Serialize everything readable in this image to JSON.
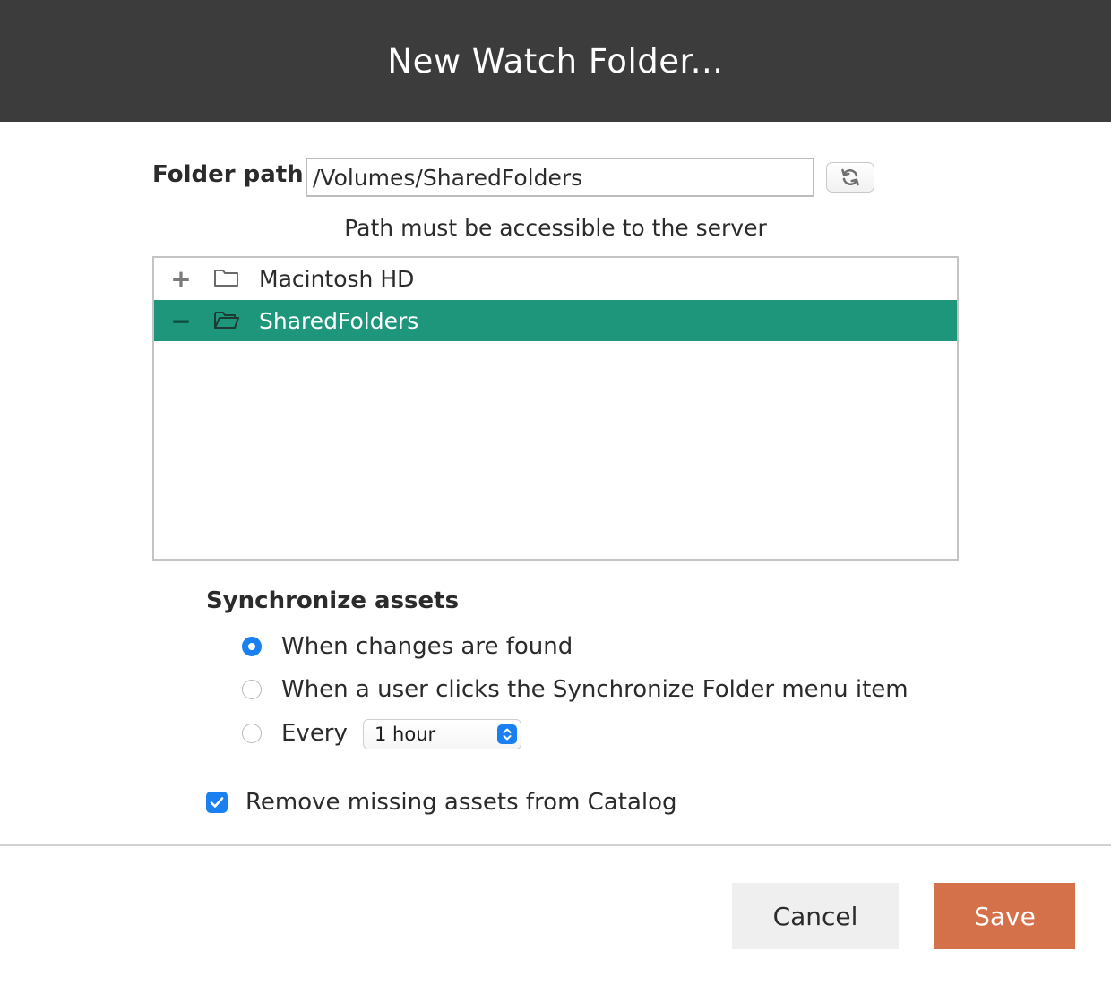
{
  "dialog": {
    "title": "New Watch Folder..."
  },
  "folder_path": {
    "label": "Folder path",
    "value": "/Volumes/SharedFolders",
    "refresh_icon": "refresh-icon",
    "hint": "Path must be accessible to the server"
  },
  "tree": {
    "items": [
      {
        "toggle": "+",
        "icon": "folder-closed-icon",
        "label": "Macintosh HD",
        "selected": false
      },
      {
        "toggle": "−",
        "icon": "folder-open-icon",
        "label": "SharedFolders",
        "selected": true
      }
    ],
    "selected_color": "#1e967c"
  },
  "sync": {
    "heading": "Synchronize assets",
    "options": [
      {
        "label": "When changes are found",
        "checked": true
      },
      {
        "label": "When a user clicks the Synchronize Folder menu item",
        "checked": false
      },
      {
        "label": "Every",
        "checked": false
      }
    ],
    "interval": {
      "selected": "1 hour"
    }
  },
  "remove_missing": {
    "label": "Remove missing assets from Catalog",
    "checked": true
  },
  "buttons": {
    "cancel": "Cancel",
    "save": "Save"
  },
  "colors": {
    "title_bar": "#3c3c3c",
    "accent_blue": "#1a7ff0",
    "save_button": "#d4704a"
  }
}
